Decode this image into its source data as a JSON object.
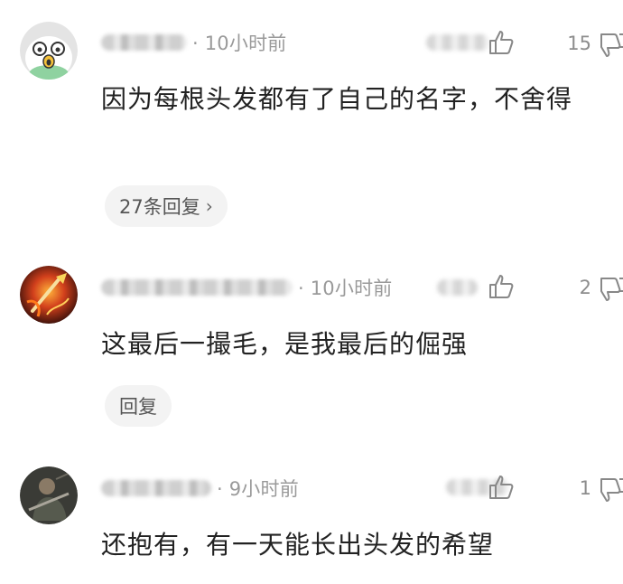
{
  "comments": [
    {
      "avatar_icon": "cartoon-face-icon",
      "time": "· 10小时前",
      "likes": "15",
      "text": "因为每根头发都有了自己的名字，不舍得",
      "reply_label": "27条回复",
      "reply_chevron": "›"
    },
    {
      "avatar_icon": "fire-sword-icon",
      "time": "· 10小时前",
      "likes": "2",
      "text": "这最后一撮毛，是我最后的倔强",
      "reply_label": "回复"
    },
    {
      "avatar_icon": "dark-figure-icon",
      "time": "· 9小时前",
      "likes": "1",
      "text": "还抱有，有一天能长出头发的希望"
    }
  ]
}
